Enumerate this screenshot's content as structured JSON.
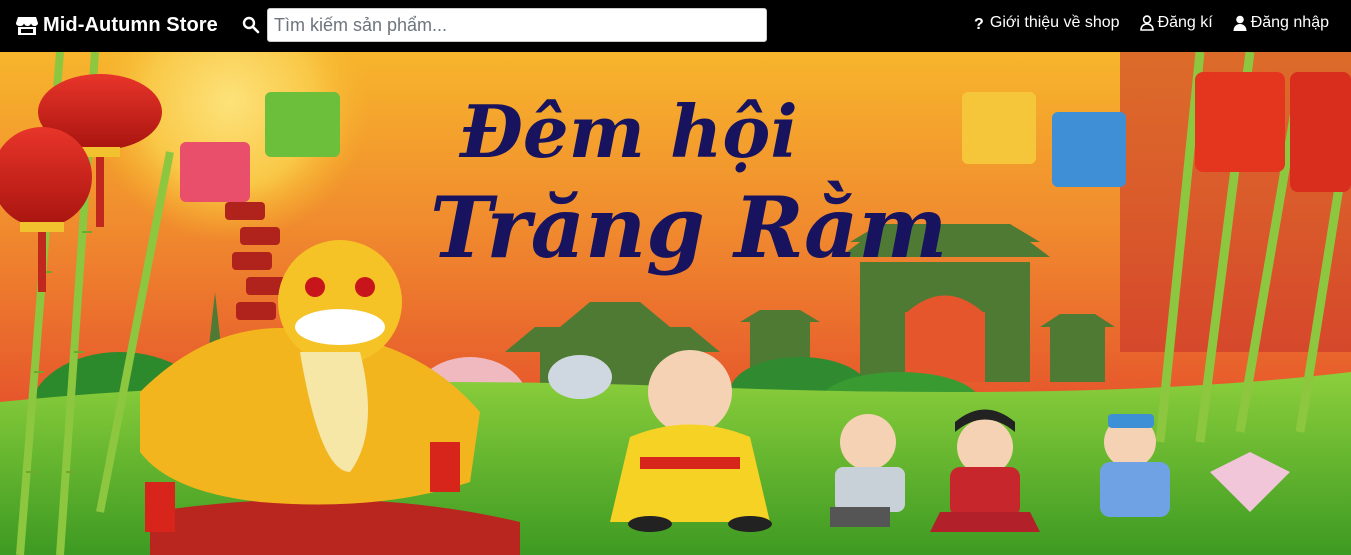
{
  "navbar": {
    "brand": {
      "icon": "store-icon",
      "label": "Mid-Autumn Store"
    },
    "search": {
      "icon": "search-icon",
      "placeholder": "Tìm kiếm sản phẩm...",
      "value": ""
    },
    "links": [
      {
        "icon": "question-icon",
        "label": "Giới thiệu về shop"
      },
      {
        "icon": "user-outline-icon",
        "label": "Đăng kí"
      },
      {
        "icon": "user-solid-icon",
        "label": "Đăng nhập"
      }
    ]
  },
  "banner": {
    "title_line1": "Đêm hội",
    "title_line2": "Trăng Rằm",
    "colors": {
      "sky_top": "#f5a623",
      "sky_mid": "#ef6a2c",
      "moon": "#f9d54a",
      "grass": "#5cb82e",
      "bamboo": "#8cc63f",
      "lantern_red": "#d7261e",
      "title": "#17135e"
    }
  }
}
